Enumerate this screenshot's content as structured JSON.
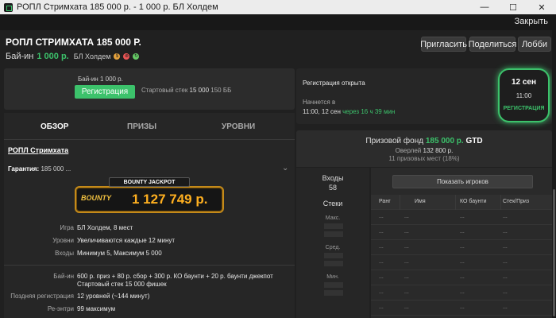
{
  "window": {
    "title": "РОПЛ Стримхата 185 000 р. - 1 000 р. БЛ Холдем",
    "controls": {
      "minimize": "—",
      "maximize": "☐",
      "close": "✕"
    }
  },
  "closebar": {
    "close_label": "Закрыть"
  },
  "header": {
    "title": "РОПЛ СТРИМХАТА 185 000 Р.",
    "buyin_label": "Бай-ин",
    "buyin_amount": "1 000 р.",
    "game": "БЛ Холдем",
    "buttons": {
      "invite": "Пригласить",
      "share": "Поделиться",
      "lobby": "Лобби"
    }
  },
  "registration": {
    "buyin": "Бай-ин 1 000 р.",
    "register_button": "Регистрация",
    "stack_label": "Стартовый стек",
    "stack_value": "15 000",
    "stack_bb": "150 ББ"
  },
  "status": {
    "registration_open": "Регистрация открыта",
    "starts_label": "Начнется в",
    "start_time": "11:00, 12 сен",
    "relative": "через 16 ч 39 мин"
  },
  "date_badge": {
    "date": "12 сен",
    "time": "11:00",
    "status": "РЕГИСТРАЦИЯ"
  },
  "tabs": {
    "overview": "ОБЗОР",
    "prizes": "ПРИЗЫ",
    "levels": "УРОВНИ"
  },
  "overview": {
    "name": "РОПЛ Стримхата",
    "guarantee_label": "Гарантия:",
    "guarantee_value": "185 000 ...",
    "jackpot_label": "BOUNTY JACKPOT",
    "jackpot_logo": "BOUNTY",
    "jackpot_amount": "1 127 749 р.",
    "details": [
      {
        "key": "Игра",
        "value": "БЛ Холдем, 8 мест"
      },
      {
        "key": "Уровни",
        "value": "Увеличиваются каждые 12 минут"
      },
      {
        "key": "Входы",
        "value": "Минимум 5, Максимум 5 000"
      }
    ],
    "buyin_key": "Бай-ин",
    "buyin_line1": "600 р. приз + 80 р. сбор + 300 р. КО баунти + 20 р. баунти джекпот",
    "buyin_line2": "Стартовый стек 15 000 фишек",
    "late_reg_key": "Поздняя регистрация",
    "late_reg_value": "12 уровней (~144 минут)",
    "reentry_key": "Ре-энтри",
    "reentry_value": "99 максимум"
  },
  "prize": {
    "fund_label": "Призовой фонд",
    "fund_amount": "185 000 р.",
    "gtd": "GTD",
    "overlay_label": "Оверлей",
    "overlay_value": "132 800 р.",
    "places": "11 призовых мест (18%)"
  },
  "stats": {
    "entries_label": "Входы",
    "entries_value": "58",
    "stacks_label": "Стеки",
    "max_label": "Макс.",
    "avg_label": "Сред.",
    "min_label": "Мин."
  },
  "players": {
    "show_button": "Показать игроков",
    "columns": [
      "Ранг",
      "Имя",
      "КО баунти",
      "Стек/Приз"
    ],
    "rows": [
      [
        "...",
        "...",
        "...",
        "..."
      ],
      [
        "...",
        "...",
        "...",
        "..."
      ],
      [
        "...",
        "...",
        "...",
        "..."
      ],
      [
        "...",
        "...",
        "...",
        "..."
      ],
      [
        "...",
        "...",
        "...",
        "..."
      ],
      [
        "...",
        "...",
        "...",
        "..."
      ],
      [
        "...",
        "...",
        "...",
        "..."
      ],
      [
        "...",
        "...",
        "...",
        "..."
      ]
    ]
  }
}
